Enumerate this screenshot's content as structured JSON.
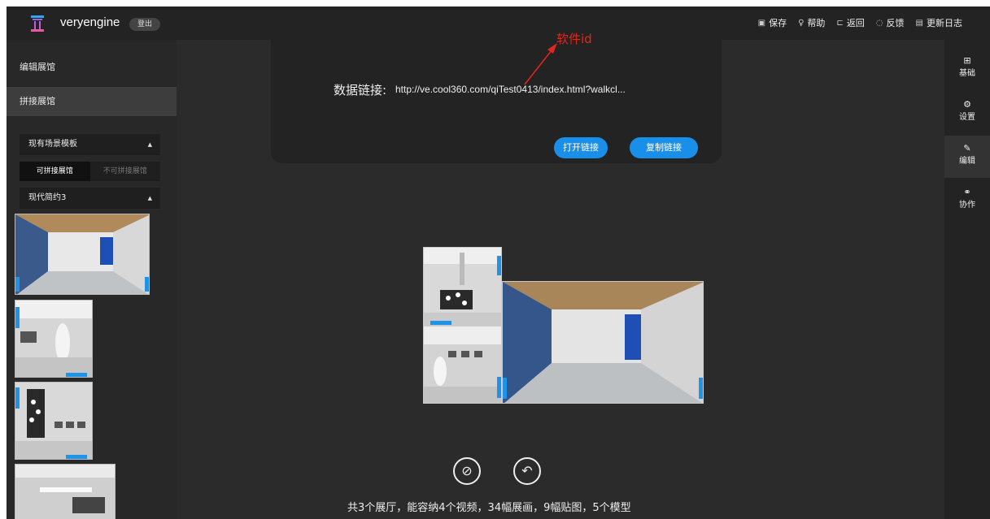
{
  "header": {
    "brand": "veryengine",
    "logout_label": "登出",
    "links": [
      {
        "icon": "save-icon",
        "glyph": "▣",
        "label": "保存"
      },
      {
        "icon": "help-icon",
        "glyph": "♀",
        "label": "帮助"
      },
      {
        "icon": "back-icon",
        "glyph": "⊏",
        "label": "返回"
      },
      {
        "icon": "feedback-icon",
        "glyph": "◌",
        "label": "反馈"
      },
      {
        "icon": "changelog-icon",
        "glyph": "▤",
        "label": "更新日志"
      }
    ]
  },
  "sidebar": {
    "nav": [
      "编辑展馆",
      "拼接展馆"
    ],
    "template_dropdown": "现有场景模板",
    "tabs": [
      "可拼接展馆",
      "不可拼接展馆"
    ],
    "style_dropdown": "现代简约3"
  },
  "panel": {
    "link_label": "数据链接:",
    "link_url": "http://ve.cool360.com/qiTest0413/index.html?walkcl...",
    "open_button": "打开链接",
    "copy_button": "复制链接",
    "annotation": "软件id"
  },
  "summary": "共3个展厅，能容纳4个视频，34幅展画，9幅贴图，5个模型",
  "right_bar": [
    {
      "icon": "basic-icon",
      "glyph": "⊞",
      "label": "基础"
    },
    {
      "icon": "settings-icon",
      "glyph": "⚙",
      "label": "设置"
    },
    {
      "icon": "edit-icon",
      "glyph": "✎",
      "label": "编辑"
    },
    {
      "icon": "collab-icon",
      "glyph": "⚭",
      "label": "协作"
    }
  ],
  "colors": {
    "accent": "#1a8fea",
    "annotation": "#e2261c",
    "background": "#2b2b2b"
  }
}
